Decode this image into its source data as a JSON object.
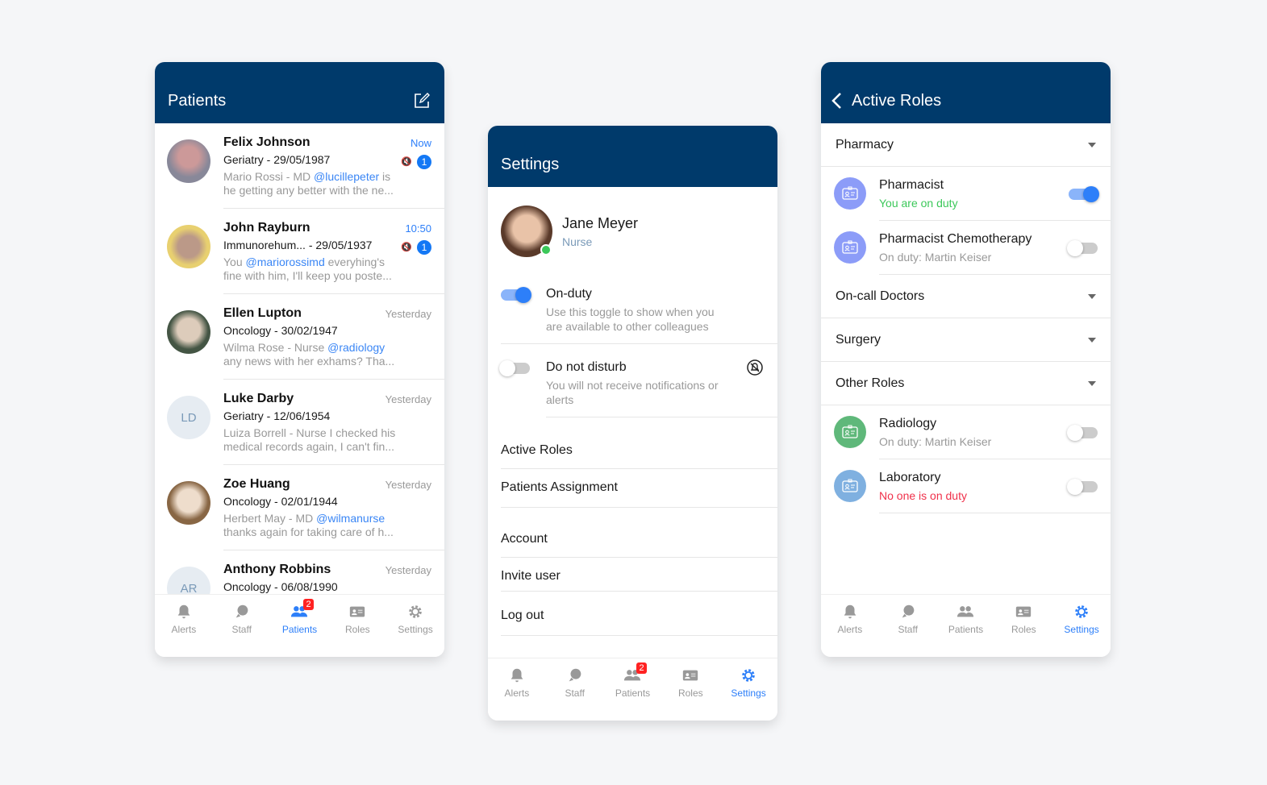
{
  "patients": {
    "title": "Patients",
    "items": [
      {
        "name": "Felix Johnson",
        "detail": "Geriatry - 29/05/1987",
        "sender": "Mario Rossi - MD",
        "mention": "@lucillepeter",
        "msg": " is he getting any better with the ne...",
        "time": "Now",
        "count": "1",
        "muted": true,
        "initials": ""
      },
      {
        "name": "John Rayburn",
        "detail": "Immunorehum... - 29/05/1937",
        "sender": "You",
        "mention": "@mariorossimd",
        "msg": " everyhing's fine with him, I'll keep you poste...",
        "time": "10:50",
        "count": "1",
        "muted": true,
        "initials": ""
      },
      {
        "name": "Ellen Lupton",
        "detail": "Oncology - 30/02/1947",
        "sender": "Wilma Rose - Nurse",
        "mention": "@radiology",
        "msg": " any news with her exhams? Tha...",
        "time": "Yesterday",
        "initials": ""
      },
      {
        "name": "Luke Darby",
        "detail": "Geriatry - 12/06/1954",
        "sender": "Luiza Borrell - Nurse",
        "mention": "",
        "msg": " I checked his medical records again, I can't fin...",
        "time": "Yesterday",
        "initials": "LD"
      },
      {
        "name": "Zoe Huang",
        "detail": "Oncology - 02/01/1944",
        "sender": "Herbert May - MD",
        "mention": "@wilmanurse",
        "msg": " thanks again for taking care of h...",
        "time": "Yesterday",
        "initials": ""
      },
      {
        "name": "Anthony Robbins",
        "detail": "Oncology - 06/08/1990",
        "sender": "",
        "mention": "",
        "msg": "",
        "time": "Yesterday",
        "initials": "AR"
      }
    ]
  },
  "nav": {
    "alerts": "Alerts",
    "staff": "Staff",
    "patients": "Patients",
    "roles": "Roles",
    "settings": "Settings",
    "patients_badge": "2"
  },
  "settings": {
    "title": "Settings",
    "user_name": "Jane Meyer",
    "user_role": "Nurse",
    "on_duty": {
      "label": "On-duty",
      "desc": "Use this toggle to show when you are available to other colleagues",
      "on": true
    },
    "dnd": {
      "label": "Do not disturb",
      "desc": "You will not receive notifications or alerts",
      "on": false
    },
    "menu": [
      "Active Roles",
      "Patients Assignment",
      "Account",
      "Invite user",
      "Log out"
    ]
  },
  "roles": {
    "title": "Active Roles",
    "groups": [
      "Pharmacy",
      "On-call Doctors",
      "Surgery",
      "Other Roles"
    ],
    "pharmacy": [
      {
        "name": "Pharmacist",
        "status": "You are on duty",
        "on": true,
        "color": "#8c9cf8",
        "status_color": "#3cc85a"
      },
      {
        "name": "Pharmacist Chemotherapy",
        "status": "On duty: Martin Keiser",
        "on": false,
        "color": "#8c9cf8",
        "status_color": "#999999"
      }
    ],
    "other": [
      {
        "name": "Radiology",
        "status": "On duty: Martin Keiser",
        "on": false,
        "color": "#5fb87a",
        "status_color": "#999999"
      },
      {
        "name": "Laboratory",
        "status": "No one is on duty",
        "on": false,
        "color": "#7fb0e0",
        "status_color": "#f0304a"
      }
    ]
  },
  "colors": {
    "header": "#003a6b",
    "accent": "#2d7ff9"
  }
}
